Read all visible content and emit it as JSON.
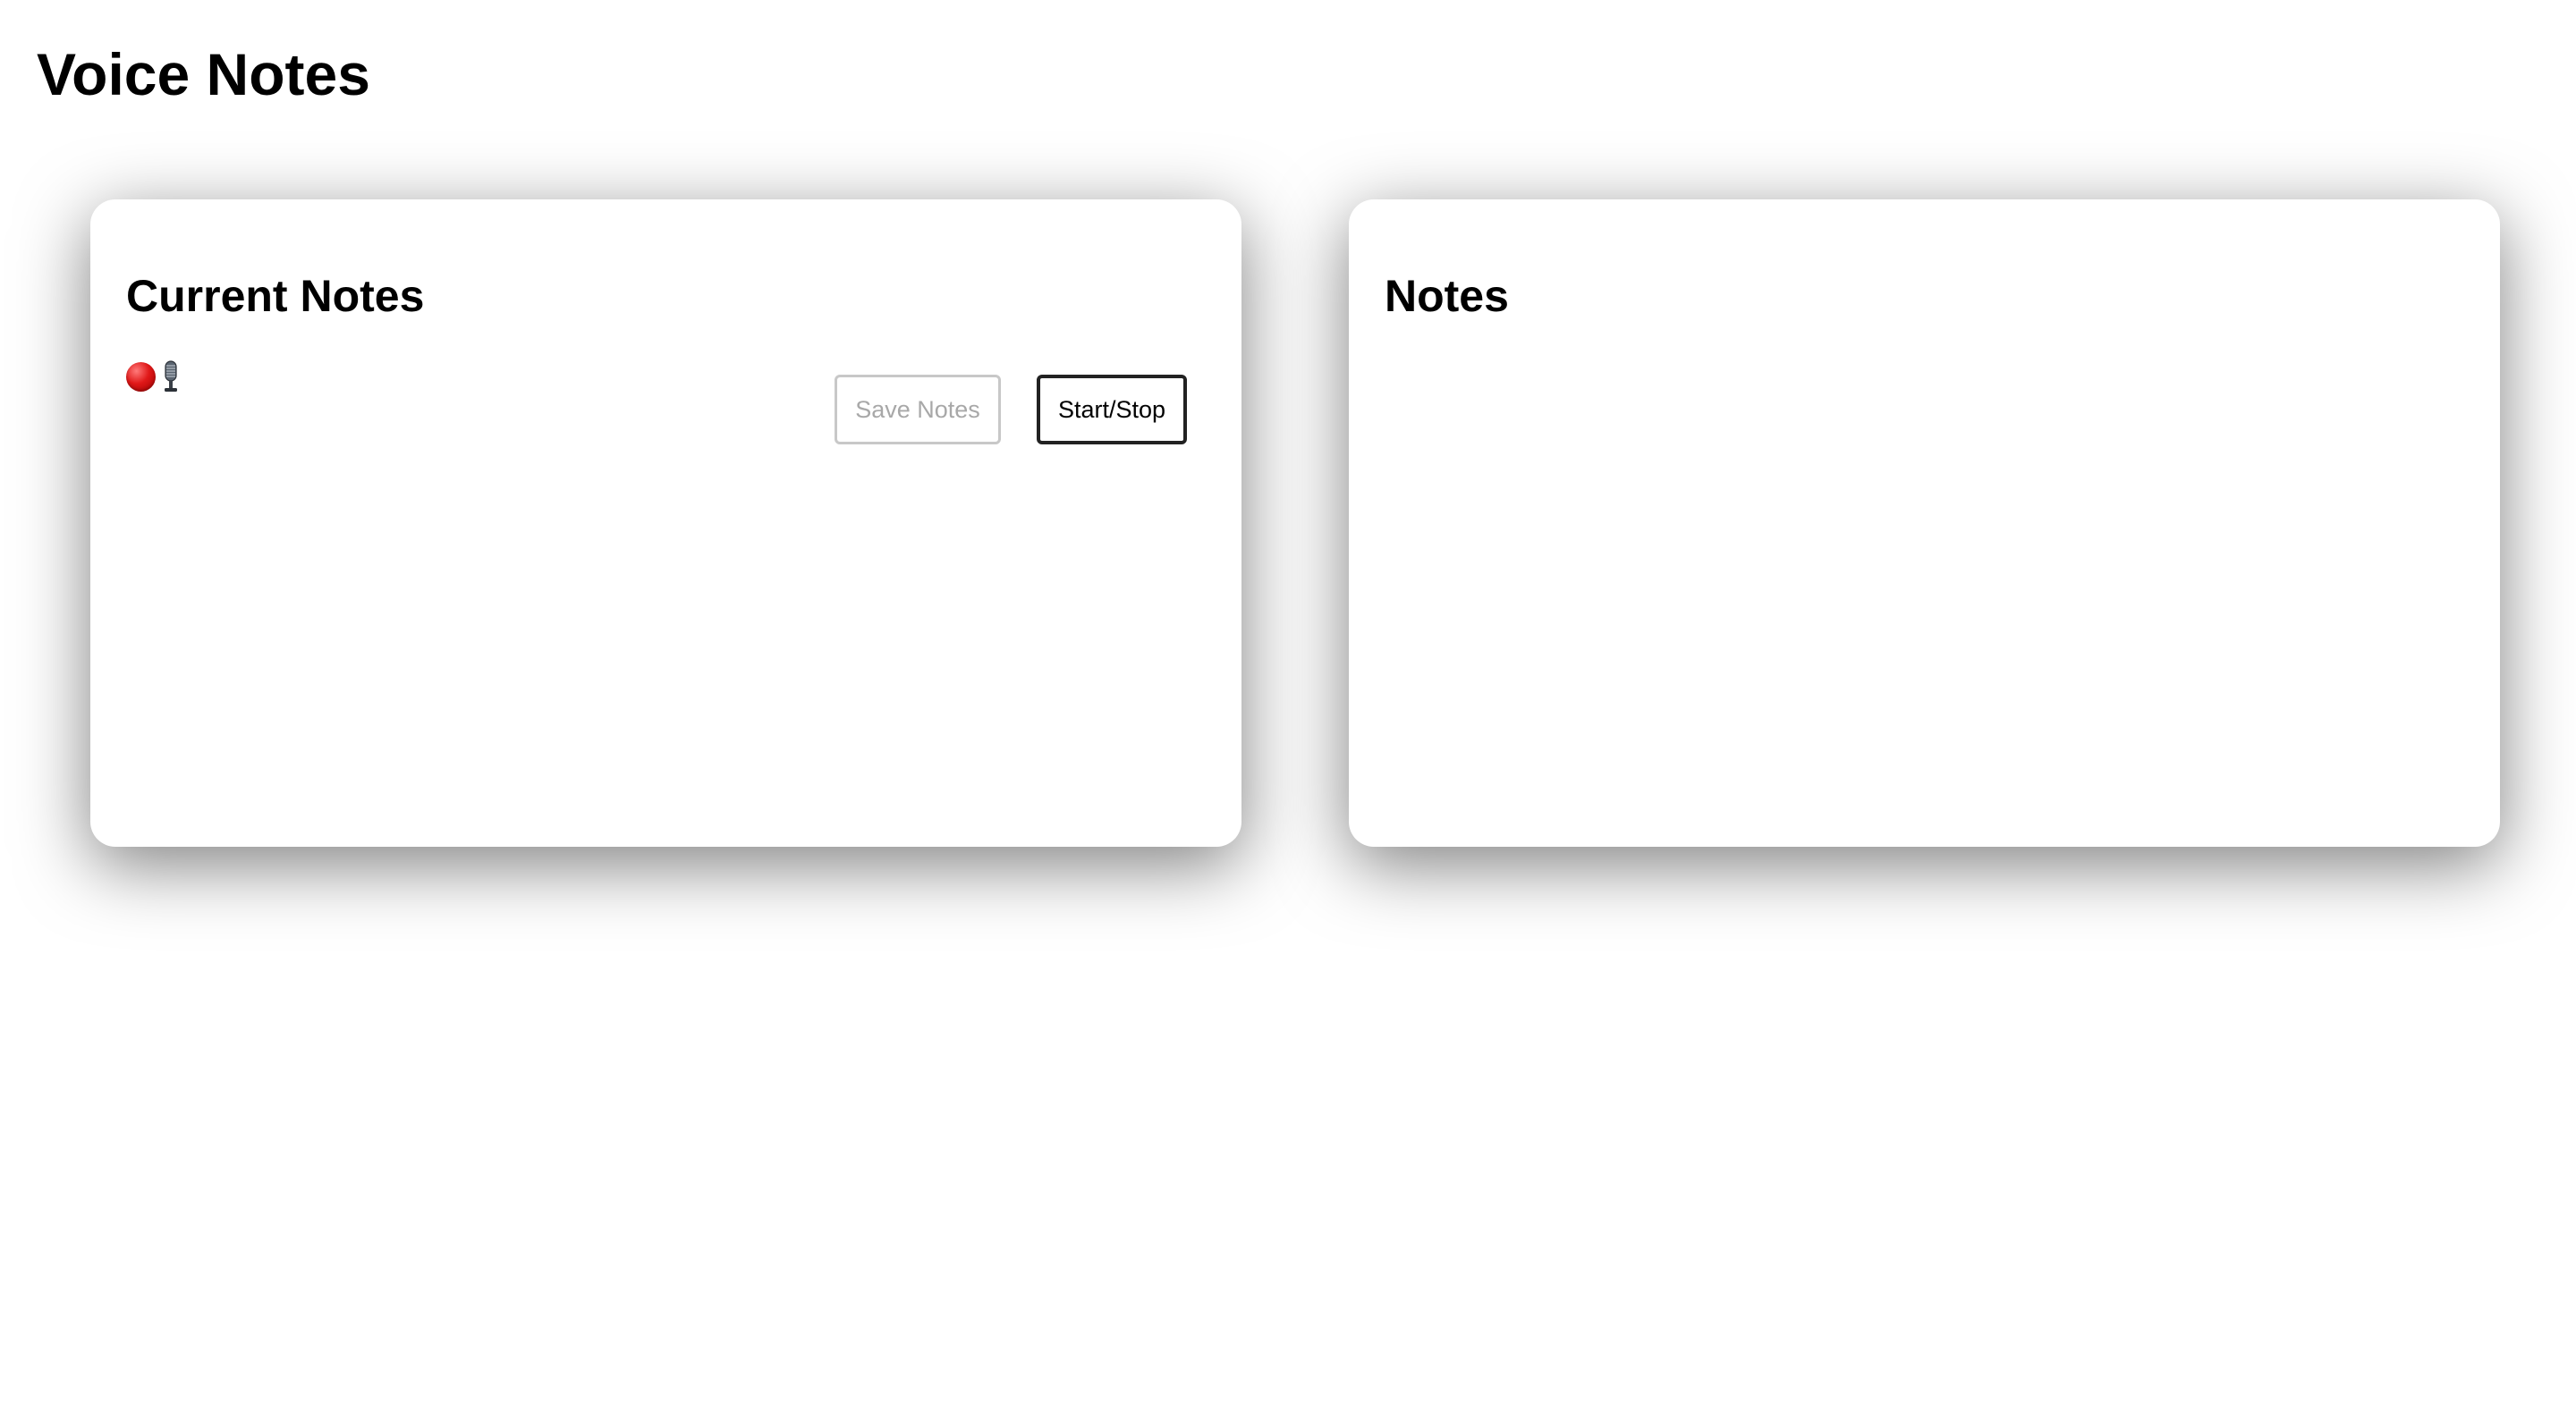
{
  "page": {
    "title": "Voice Notes"
  },
  "current_notes_panel": {
    "title": "Current Notes",
    "status_icons": [
      "red-circle-icon",
      "microphone-icon"
    ],
    "save_button_label": "Save Notes",
    "save_button_disabled": true,
    "start_stop_button_label": "Start/Stop"
  },
  "notes_panel": {
    "title": "Notes",
    "items": []
  },
  "colors": {
    "background": "#ffffff",
    "text": "#000000",
    "disabled_text": "#a8a8a8",
    "recording_indicator": "#e01818"
  }
}
